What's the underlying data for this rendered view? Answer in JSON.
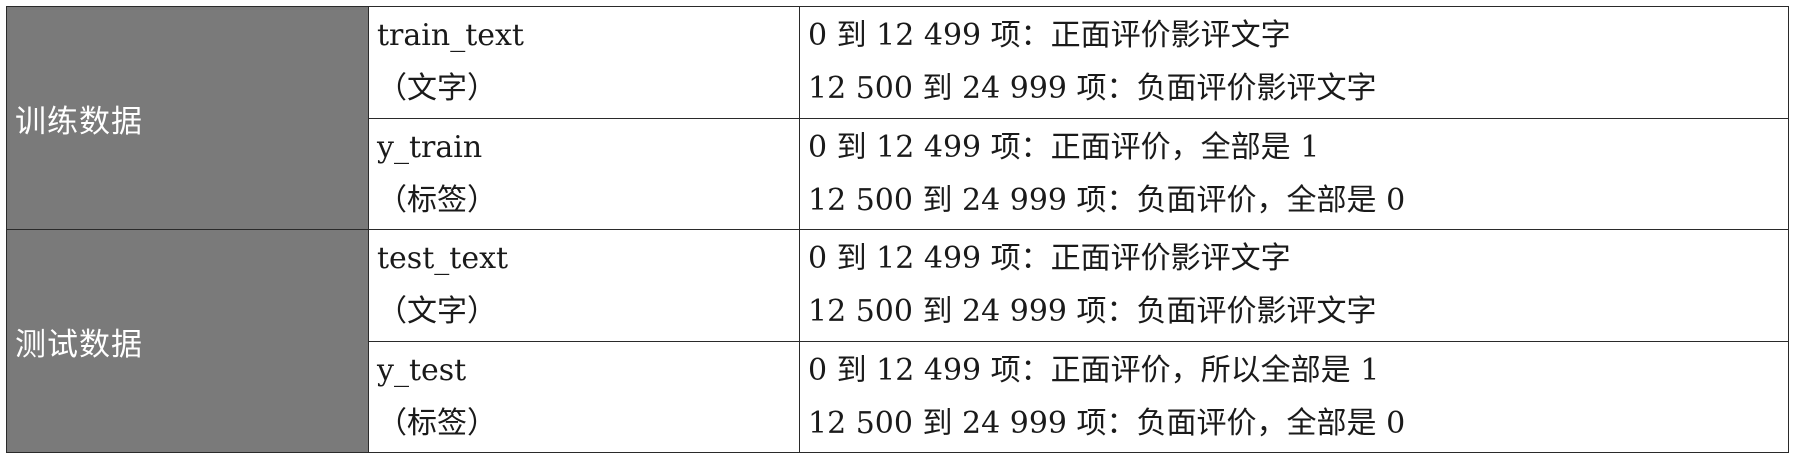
{
  "groups": [
    {
      "label": "训练数据",
      "rows": [
        {
          "field_name": "train_text",
          "field_type": "（文字）",
          "desc_line1": "0 到 12 499 项：正面评价影评文字",
          "desc_line2": "12 500 到 24 999 项：负面评价影评文字"
        },
        {
          "field_name": "y_train",
          "field_type": "（标签）",
          "desc_line1": "0 到 12 499 项：正面评价，全部是 1",
          "desc_line2": "12 500 到 24 999 项：负面评价，全部是 0"
        }
      ]
    },
    {
      "label": "测试数据",
      "rows": [
        {
          "field_name": "test_text",
          "field_type": "（文字）",
          "desc_line1": "0 到 12 499 项：正面评价影评文字",
          "desc_line2": "12 500 到 24 999 项：负面评价影评文字"
        },
        {
          "field_name": "y_test",
          "field_type": "（标签）",
          "desc_line1": "0 到 12 499 项：正面评价，所以全部是 1",
          "desc_line2": "12 500 到 24 999 项：负面评价，全部是 0"
        }
      ]
    }
  ],
  "colors": {
    "group_background": "#7a7a7a",
    "group_text": "#ffffff",
    "border": "#2a2a2a"
  }
}
